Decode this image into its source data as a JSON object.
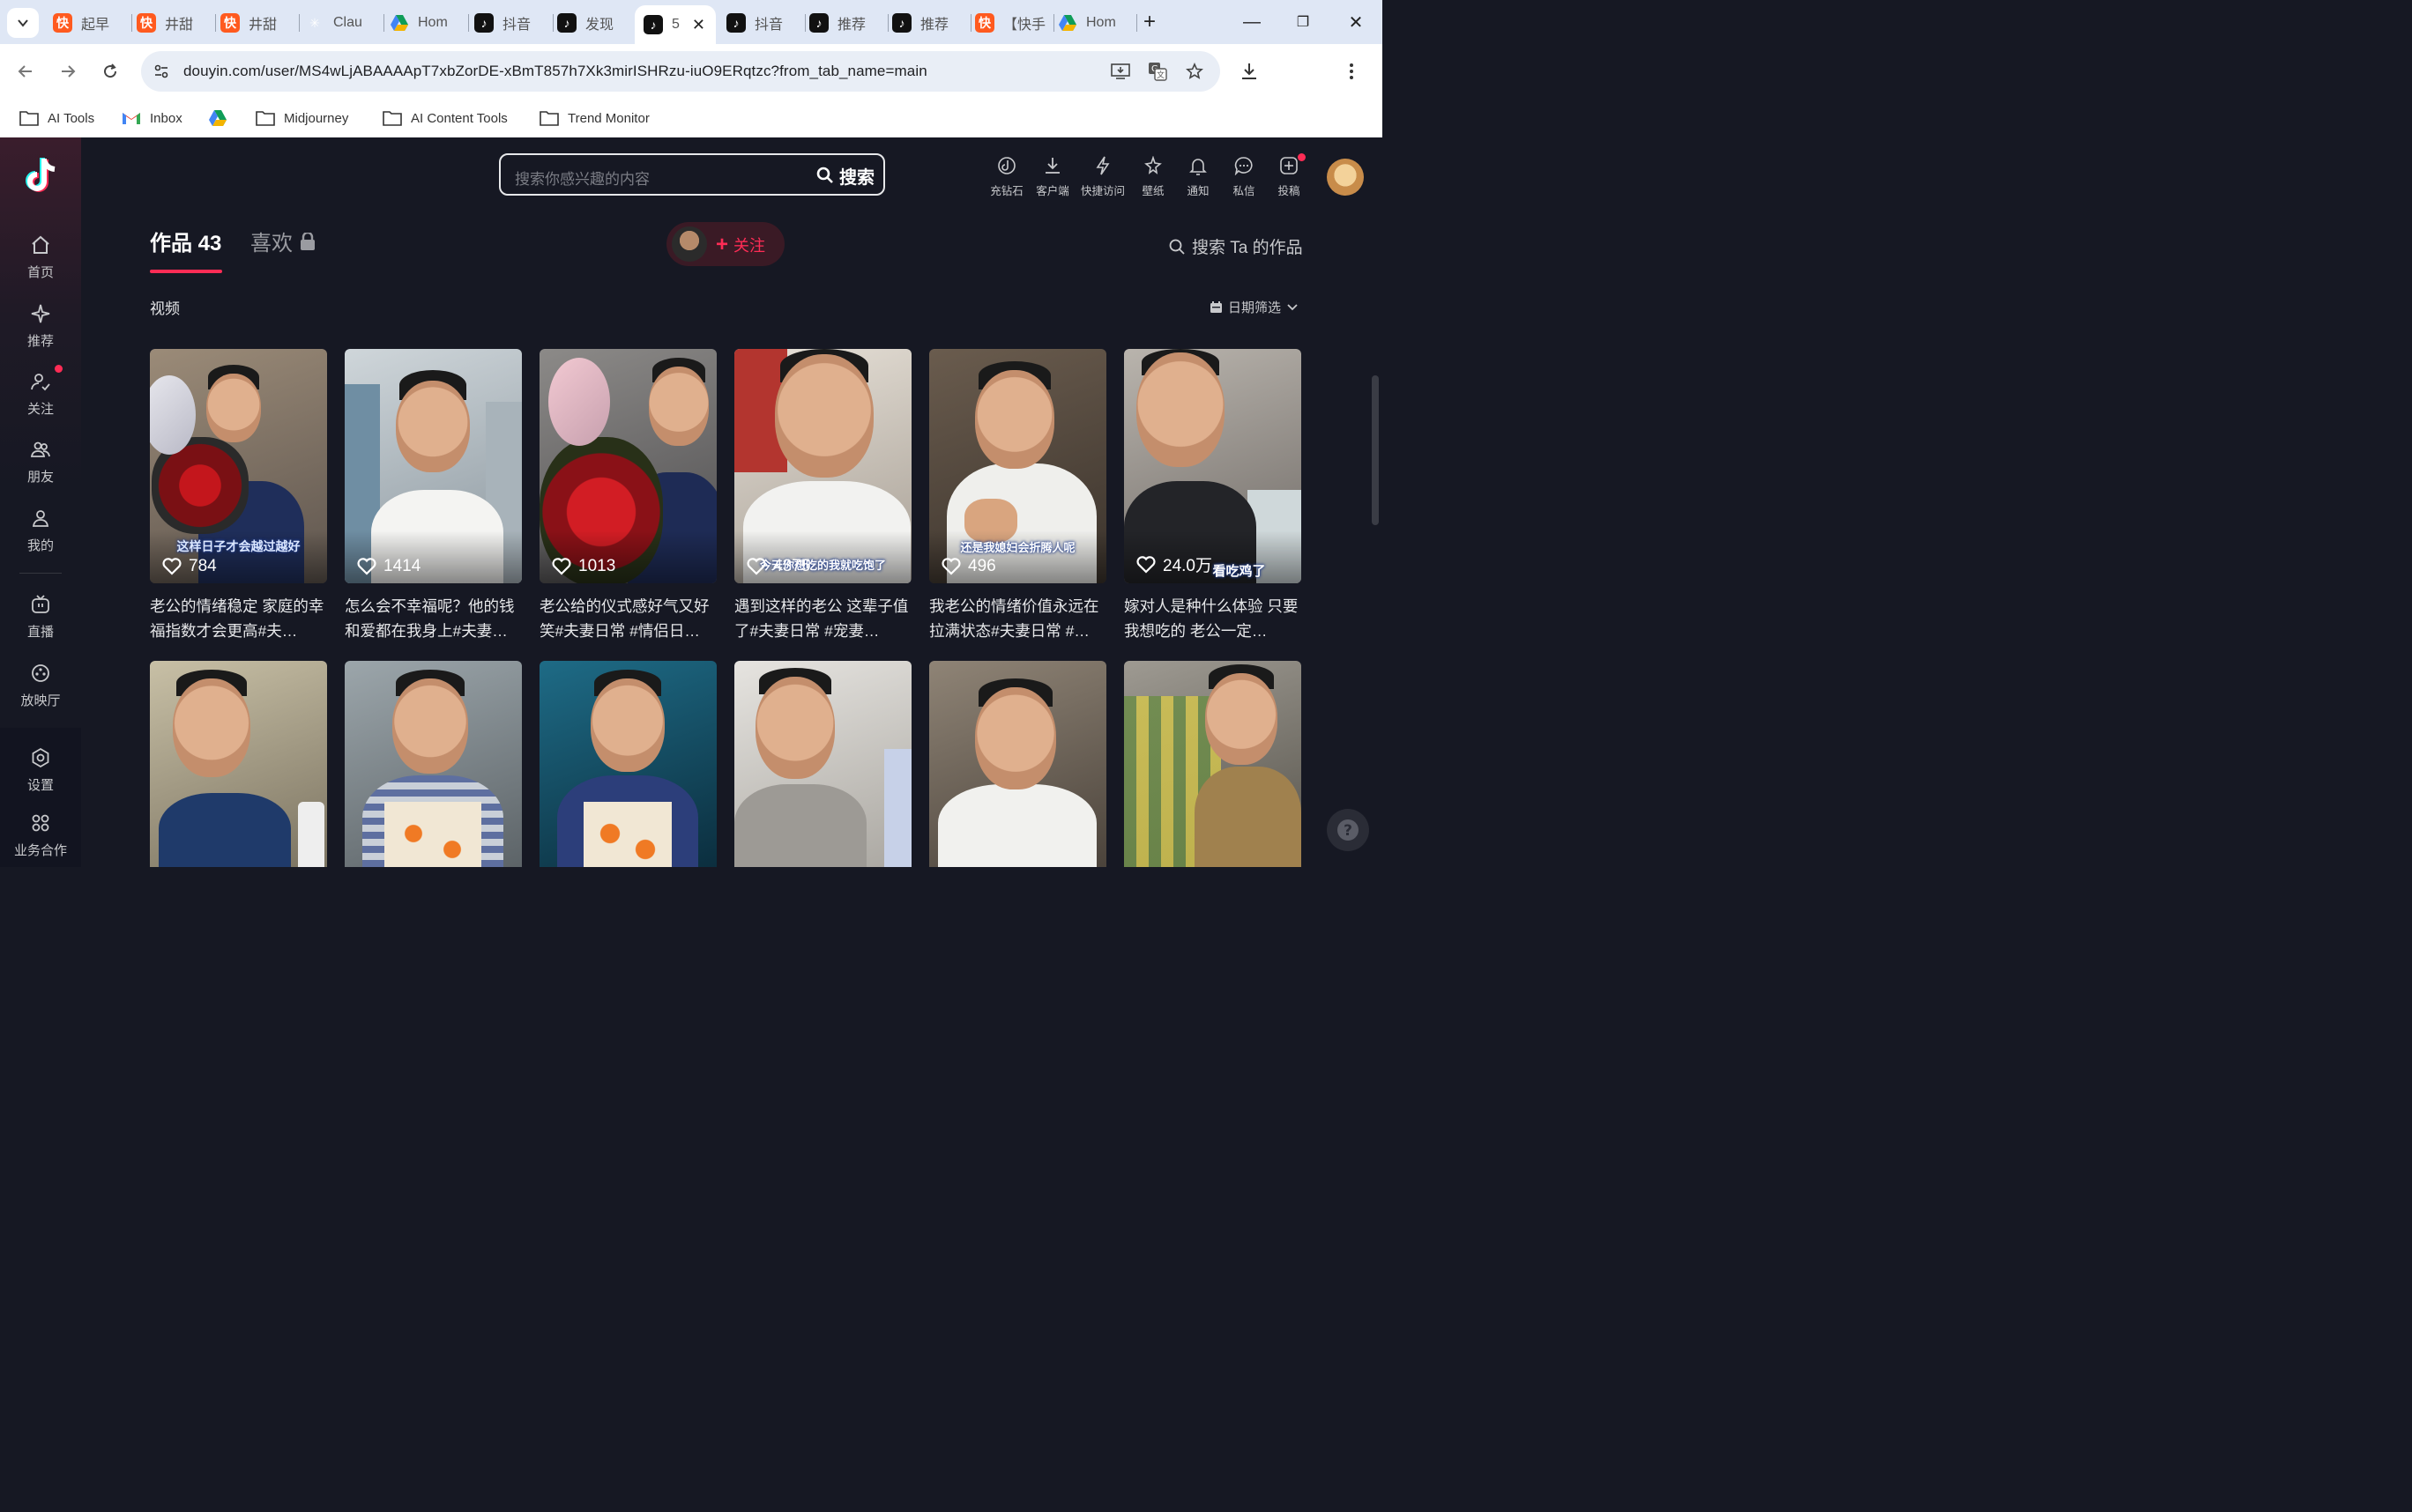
{
  "browser": {
    "tabs": [
      {
        "label": "起早",
        "icon": "kuaishou-icon"
      },
      {
        "label": "井甜",
        "icon": "kuaishou-icon"
      },
      {
        "label": "井甜",
        "icon": "kuaishou-icon"
      },
      {
        "label": "Clau",
        "icon": "claude-icon"
      },
      {
        "label": "Hom",
        "icon": "google-drive-icon"
      },
      {
        "label": "抖音",
        "icon": "douyin-icon"
      },
      {
        "label": "发现",
        "icon": "douyin-icon"
      },
      {
        "label": "5",
        "icon": "douyin-icon",
        "active": true
      },
      {
        "label": "抖音",
        "icon": "douyin-icon"
      },
      {
        "label": "推荐",
        "icon": "douyin-icon"
      },
      {
        "label": "推荐",
        "icon": "douyin-icon"
      },
      {
        "label": "【快手",
        "icon": "kuaishou-icon"
      },
      {
        "label": "Hom",
        "icon": "google-drive-icon"
      }
    ],
    "url": "douyin.com/user/MS4wLjABAAAApT7xbZorDE-xBmT857h7Xk3mirISHRzu-iuO9ERqtzc?from_tab_name=main",
    "bookmarks": [
      {
        "label": "AI Tools",
        "icon": "folder-icon"
      },
      {
        "label": "Inbox",
        "icon": "gmail-icon"
      },
      {
        "label": "",
        "icon": "google-drive-icon"
      },
      {
        "label": "Midjourney",
        "icon": "folder-icon"
      },
      {
        "label": "AI Content Tools",
        "icon": "folder-icon"
      },
      {
        "label": "Trend Monitor",
        "icon": "folder-icon"
      }
    ]
  },
  "sidebar": {
    "items": [
      {
        "label": "首页",
        "icon": "home-icon"
      },
      {
        "label": "推荐",
        "icon": "sparkle-icon"
      },
      {
        "label": "关注",
        "icon": "follow-icon",
        "dot": true
      },
      {
        "label": "朋友",
        "icon": "friends-icon"
      },
      {
        "label": "我的",
        "icon": "profile-icon"
      },
      {
        "label": "直播",
        "icon": "tv-icon"
      },
      {
        "label": "放映厅",
        "icon": "cinema-icon"
      },
      {
        "label": "设置",
        "icon": "settings-icon"
      },
      {
        "label": "业务合作",
        "icon": "grid-icon"
      }
    ]
  },
  "header": {
    "search_placeholder": "搜索你感兴趣的内容",
    "search_button": "搜索",
    "actions": [
      {
        "label": "充钻石",
        "icon": "diamond-icon"
      },
      {
        "label": "客户端",
        "icon": "download-icon"
      },
      {
        "label": "快捷访问",
        "icon": "lightning-icon"
      },
      {
        "label": "壁纸",
        "icon": "wallpaper-icon"
      },
      {
        "label": "通知",
        "icon": "bell-icon"
      },
      {
        "label": "私信",
        "icon": "message-icon"
      },
      {
        "label": "投稿",
        "icon": "upload-icon",
        "dot": true
      }
    ]
  },
  "profile": {
    "tab_works": "作品 43",
    "tab_likes": "喜欢",
    "follow_label": "关注",
    "search_works": "搜索 Ta 的作品",
    "section_title": "视频",
    "date_filter": "日期筛选"
  },
  "videos": [
    {
      "likes": "784",
      "title": "老公的情绪稳定 家庭的幸福指数才会更高#夫…",
      "overlay": "这样日子才会越过越好"
    },
    {
      "likes": "1414",
      "title": "怎么会不幸福呢？他的钱和爱都在我身上#夫妻…",
      "overlay": ""
    },
    {
      "likes": "1013",
      "title": "老公给的仪式感好气又好笑#夫妻日常 #情侣日…",
      "overlay": ""
    },
    {
      "likes": "4375",
      "title": "遇到这样的老公 这辈子值了#夫妻日常 #宠妻…",
      "overlay": "今天你想吃的我就吃饱了"
    },
    {
      "likes": "496",
      "title": "我老公的情绪价值永远在拉满状态#夫妻日常 #…",
      "overlay": "还是我媳妇会折腾人呢"
    },
    {
      "likes": "24.0万",
      "title": "嫁对人是种什么体验 只要我想吃的 老公一定…",
      "overlay": "看吃鸡了"
    }
  ],
  "colors": {
    "accent": "#fe2c55",
    "page_bg": "#161823",
    "chrome_tabbar": "#dfe7f5"
  }
}
